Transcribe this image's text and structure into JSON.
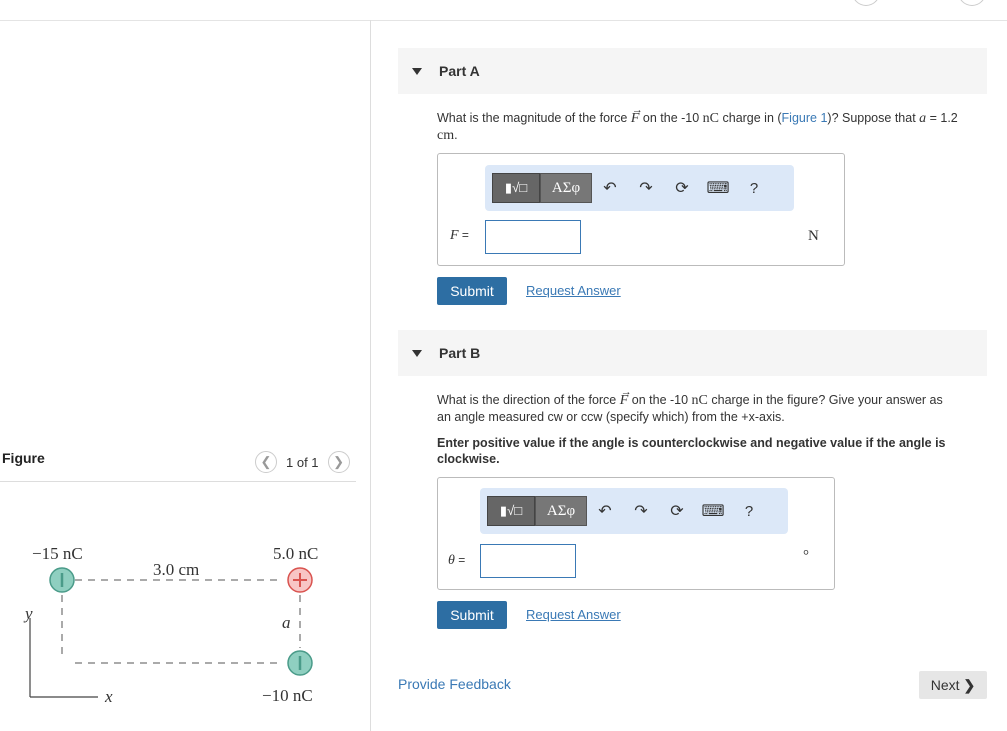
{
  "figure": {
    "title": "Figure",
    "pager_text": "1 of 1",
    "prev_icon": "chevron-left-icon",
    "next_icon": "chevron-right-icon",
    "labels": {
      "q1": "−15 nC",
      "q2": "5.0 nC",
      "q3": "−10 nC",
      "distance": "3.0 cm",
      "a": "a",
      "x": "x",
      "y": "y"
    },
    "colors": {
      "negative": "#8fcfc0",
      "positive": "#f4a4a4",
      "negative_stroke": "#4a9b89",
      "positive_stroke": "#d9534f"
    }
  },
  "partA": {
    "title": "Part A",
    "question_pre": "What is the magnitude of the force ",
    "force_symbol": "F",
    "question_mid": " on the -10 ",
    "unit_nC": "nC",
    "question_mid2": " charge in (",
    "figure_link": "Figure 1",
    "question_post": ")? Suppose that ",
    "a_var": "a",
    "question_eq": " = 1.2",
    "question_unit": "cm",
    "question_end": ".",
    "field_label": "F",
    "field_eq": " =",
    "input_value": "",
    "unit": "N",
    "submit_label": "Submit",
    "request_label": "Request Answer"
  },
  "partB": {
    "title": "Part B",
    "question_pre": "What is the direction of the force ",
    "force_symbol": "F",
    "question_mid": " on the -10 ",
    "unit_nC": "nC",
    "question_post": " charge in the figure? Give your answer as",
    "question_line2": "an angle measured cw or ccw (specify which) from the +x-axis.",
    "instruction_line1": "Enter positive value if the angle is counterclockwise and negative value if the angle is",
    "instruction_line2": "clockwise.",
    "field_label": "θ",
    "field_eq": " =",
    "input_value": "",
    "unit": "°",
    "submit_label": "Submit",
    "request_label": "Request Answer"
  },
  "toolbar": {
    "template_label": "▮√□",
    "greek_label": "ΑΣφ",
    "undo_icon": "undo-icon",
    "redo_icon": "redo-icon",
    "reset_icon": "reset-icon",
    "keyboard_icon": "keyboard-icon",
    "help_label": "?"
  },
  "footer": {
    "feedback_label": "Provide Feedback",
    "next_label": "Next"
  },
  "colors": {
    "accent": "#2d6ea3",
    "link": "#3a79b5"
  }
}
